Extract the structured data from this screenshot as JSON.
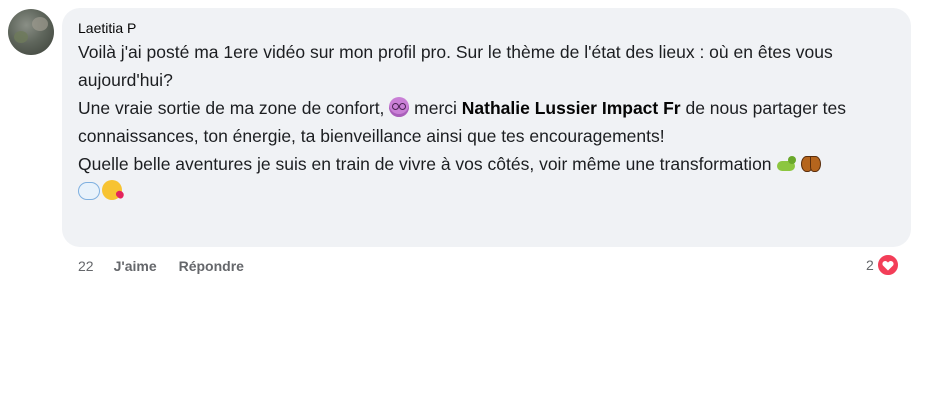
{
  "comment": {
    "author": "Laetitia P",
    "lines": {
      "p1": "Voilà j'ai posté ma 1ere vidéo sur mon profil pro. Sur le thème de l'état des lieux : où en êtes vous aujourd'hui?",
      "p2_before": "Une vraie sortie de ma zone de confort, ",
      "p2_middle": " merci ",
      "mention": "Nathalie Lussier Impact Fr",
      "p2_after": " de nous partager tes connaissances, ton énergie, ta bienveillance ainsi que tes encouragements!",
      "p3": "Quelle belle aventures je suis en train de vivre à vos côtés, voir même une transformation"
    },
    "emojis": [
      "dizzy-face-emoji",
      "caterpillar-emoji",
      "butterfly-emoji",
      "speech-bubble-emoji",
      "kiss-face-emoji"
    ]
  },
  "meta": {
    "time": "22",
    "like_label": "J'aime",
    "reply_label": "Répondre",
    "reaction_count": "2",
    "reaction_type": "heart-icon"
  },
  "colors": {
    "bubble_bg": "#f0f2f5",
    "meta_text": "#65676b",
    "heart": "#f33e58"
  }
}
